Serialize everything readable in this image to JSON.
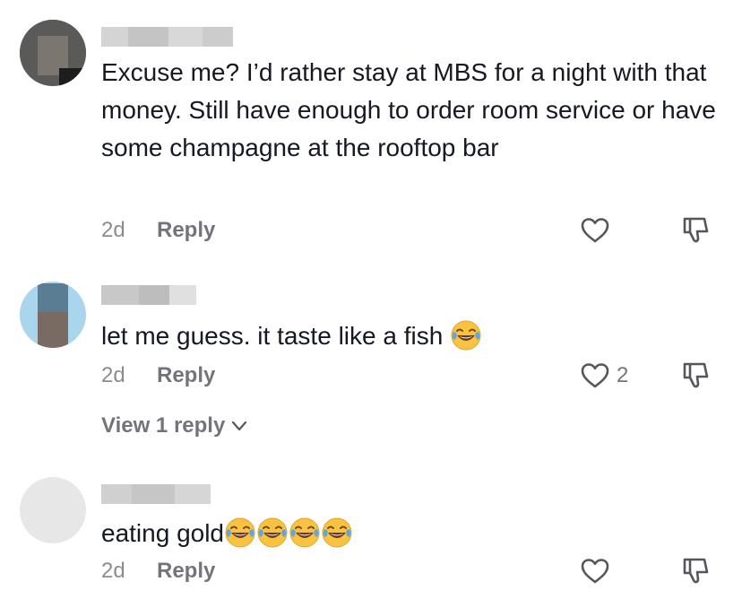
{
  "comments": [
    {
      "text": "Excuse me? I’d rather stay at MBS for a night with that money. Still have enough to order room service or have some champagne at the rooftop bar",
      "age": "2d",
      "reply_label": "Reply",
      "likes": ""
    },
    {
      "text": "let me guess. it taste like a fish",
      "age": "2d",
      "reply_label": "Reply",
      "likes": "2",
      "view_replies_label": "View 1 reply"
    },
    {
      "text": "eating gold",
      "age": "2d",
      "reply_label": "Reply",
      "likes": ""
    }
  ],
  "icons": {
    "like": "heart-outline-icon",
    "dislike": "thumbs-down-outline-icon",
    "expand": "chevron-down-icon",
    "emoji": "face-with-tears-of-joy-emoji"
  },
  "colors": {
    "text_primary": "#161823",
    "text_secondary": "#8a8b91",
    "emoji_face": "#f9c240",
    "emoji_tears": "#5aa9e6"
  }
}
